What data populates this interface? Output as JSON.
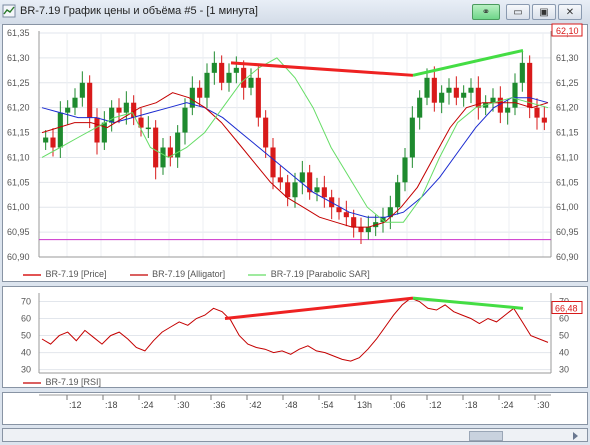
{
  "window": {
    "title": "BR-7.19 График цены и объёма #5 - [1 минута]"
  },
  "buttons": {
    "link": "⚭",
    "minimize": "▭",
    "maximize": "▣",
    "close": "✕"
  },
  "price_panel": {
    "y_ticks": [
      "61,35",
      "61,30",
      "61,25",
      "61,20",
      "61,15",
      "61,10",
      "61,05",
      "61,00",
      "60,95",
      "60,90"
    ],
    "last_price": "62,10",
    "legend": [
      "BR-7.19 [Price]",
      "BR-7.19 [Alligator]",
      "BR-7.19 [Parabolic SAR]"
    ]
  },
  "rsi_panel": {
    "y_ticks": [
      "70",
      "60",
      "50",
      "40",
      "30"
    ],
    "last_value": "66,48",
    "legend": "BR-7.19 [RSI]"
  },
  "time_axis": {
    "labels": [
      ":12",
      ":18",
      ":24",
      ":30",
      ":36",
      ":42",
      ":48",
      ":54",
      "13h",
      ":06",
      ":12",
      ":18",
      ":24",
      ":30"
    ]
  },
  "colors": {
    "up": "#1e8a2e",
    "down": "#d81a1a",
    "alligator": "#c40000",
    "sar": "#66dd66",
    "ma_blue": "#1a2ad0",
    "support": "#cc33cc",
    "bear_div": "#ee2222",
    "bull_div": "#44dd44"
  },
  "chart_data": {
    "type": "line",
    "price_ylim": [
      60.9,
      61.35
    ],
    "rsi_ylim": [
      28,
      75
    ],
    "support_level": 60.935,
    "series": [
      {
        "name": "BR-7.19 [Price]",
        "values": [
          61.14,
          61.12,
          61.19,
          61.2,
          61.22,
          61.25,
          61.18,
          61.13,
          61.17,
          61.2,
          61.19,
          61.21,
          61.18,
          61.16,
          61.16,
          61.08,
          61.12,
          61.1,
          61.15,
          61.2,
          61.24,
          61.22,
          61.27,
          61.29,
          61.25,
          61.27,
          61.28,
          61.24,
          61.26,
          61.18,
          61.12,
          61.06,
          61.05,
          61.02,
          61.05,
          61.07,
          61.03,
          61.04,
          61.02,
          61.0,
          60.99,
          60.98,
          60.96,
          60.95,
          60.96,
          60.97,
          60.98,
          61.0,
          61.05,
          61.1,
          61.18,
          61.22,
          61.26,
          61.21,
          61.23,
          61.24,
          61.22,
          61.23,
          61.24,
          61.2,
          61.21,
          61.22,
          61.19,
          61.2,
          61.25,
          61.29,
          61.2,
          61.18,
          61.17
        ]
      },
      {
        "name": "BR-7.19 [Alligator]",
        "values": [
          61.15,
          61.16,
          61.17,
          61.17,
          61.16,
          61.18,
          61.2,
          61.21,
          61.23,
          61.22,
          61.2,
          61.17,
          61.13,
          61.09,
          61.05,
          61.02,
          61.0,
          60.98,
          60.97,
          60.96,
          60.96,
          60.97,
          61.0,
          61.04,
          61.1,
          61.16,
          61.2,
          61.21,
          61.21,
          61.21,
          61.2,
          61.21
        ]
      },
      {
        "name": "BR-7.19 [Parabolic SAR]",
        "values": [
          61.1,
          61.12,
          61.14,
          61.16,
          61.18,
          61.19,
          61.12,
          61.1,
          61.12,
          61.15,
          61.2,
          61.25,
          61.28,
          61.3,
          61.26,
          61.2,
          61.12,
          61.06,
          61.0,
          60.97,
          60.97,
          61.02,
          61.1,
          61.17,
          61.2,
          61.21,
          61.22,
          61.21,
          61.2
        ]
      },
      {
        "name": "MA",
        "values": [
          61.2,
          61.19,
          61.18,
          61.18,
          61.17,
          61.18,
          61.19,
          61.2,
          61.21,
          61.2,
          61.18,
          61.15,
          61.12,
          61.09,
          61.06,
          61.03,
          61.01,
          60.99,
          60.98,
          60.98,
          60.99,
          61.02,
          61.06,
          61.11,
          61.16,
          61.2,
          61.22,
          61.22,
          61.21
        ]
      },
      {
        "name": "BR-7.19 [RSI]",
        "values": [
          48,
          45,
          50,
          52,
          47,
          53,
          49,
          45,
          50,
          52,
          48,
          43,
          41,
          47,
          52,
          55,
          58,
          56,
          60,
          62,
          66,
          64,
          59,
          50,
          45,
          43,
          42,
          40,
          41,
          39,
          42,
          44,
          41,
          40,
          38,
          36,
          35,
          37,
          42,
          48,
          55,
          62,
          68,
          72,
          70,
          66,
          65,
          68,
          64,
          62,
          60,
          57,
          60,
          58,
          62,
          66,
          58,
          50,
          48,
          46
        ]
      }
    ]
  }
}
